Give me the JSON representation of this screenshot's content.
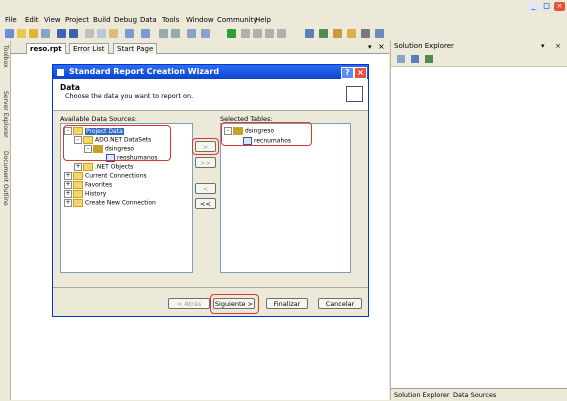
{
  "window": {
    "minimize": "_",
    "maximize": "□",
    "close": "×"
  },
  "menu": [
    "File",
    "Edit",
    "View",
    "Project",
    "Build",
    "Debug",
    "Data",
    "Tools",
    "Window",
    "Community",
    "Help"
  ],
  "left_strip": [
    "Toolbox",
    "Server Explorer",
    "Document Outline"
  ],
  "doc_tabs": [
    "reso.rpt",
    "Error List",
    "Start Page"
  ],
  "solution_explorer": {
    "title": "Solution Explorer",
    "bottom_tabs": [
      "Solution Explorer",
      "Data Sources"
    ]
  },
  "dialog": {
    "title": "Standard Report Creation Wizard",
    "help": "?",
    "close": "×",
    "header_title": "Data",
    "header_subtitle": "Choose the data you want to report on.",
    "available_label": "Available Data Sources:",
    "selected_label": "Selected Tables:",
    "tree": {
      "project_data": "Project Data",
      "ado_datasets": "ADO.NET DataSets",
      "dsingreso": "dsingreso",
      "reoshumanos": "reoshumanos",
      "net_objects": ".NET Objects",
      "current_connections": "Current Connections",
      "favorites": "Favorites",
      "history": "History",
      "create_new": "Create New Connection"
    },
    "selected": {
      "dataset": "dsingreso",
      "table": "recnumahos"
    },
    "move_buttons": [
      ">",
      ">>",
      "<",
      "<<"
    ],
    "footer": {
      "back": "< Atrás",
      "next": "Siguiente >",
      "finish": "Finalizar",
      "cancel": "Cancelar"
    }
  }
}
